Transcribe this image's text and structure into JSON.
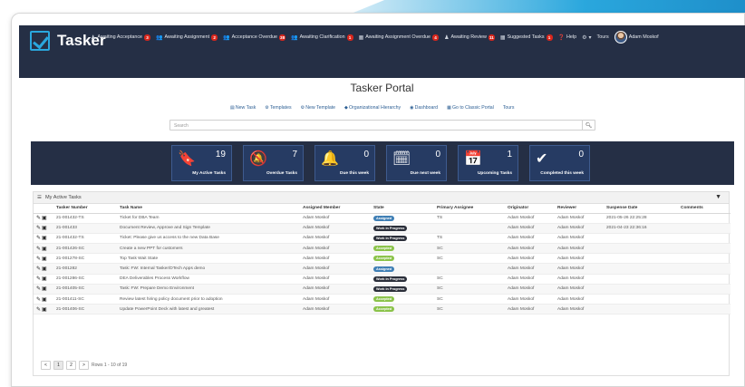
{
  "brand": "Tasker",
  "nav": [
    {
      "icon": "user-icon",
      "glyph": "♟",
      "label": "Awaiting Acceptance",
      "count": "3"
    },
    {
      "icon": "users-icon",
      "glyph": "👥",
      "label": "Awaiting Assignment",
      "count": "2"
    },
    {
      "icon": "users-icon",
      "glyph": "👥",
      "label": "Acceptance Overdue",
      "count": "38"
    },
    {
      "icon": "users-icon",
      "glyph": "👥",
      "label": "Awaiting Clarification",
      "count": "1"
    },
    {
      "icon": "bank-icon",
      "glyph": "▦",
      "label": "Awaiting Assignment Overdue",
      "count": "4"
    },
    {
      "icon": "user-icon",
      "glyph": "♟",
      "label": "Awaiting Review",
      "count": "11"
    },
    {
      "icon": "bank-icon",
      "glyph": "▦",
      "label": "Suggested Tasks",
      "count": "1"
    }
  ],
  "help_label": "Help",
  "tours_label": "Tours",
  "user_name": "Adam Moskof",
  "portal_title": "Tasker Portal",
  "links": [
    {
      "name": "new-task-link",
      "icon": "▤",
      "label": "New Task"
    },
    {
      "name": "templates-link",
      "icon": "⚙",
      "label": "Templates"
    },
    {
      "name": "new-template-link",
      "icon": "⚙",
      "label": "New Template"
    },
    {
      "name": "org-hierarchy-link",
      "icon": "◆",
      "label": "Organizational Hierarchy"
    },
    {
      "name": "dashboard-link",
      "icon": "◉",
      "label": "Dashboard"
    },
    {
      "name": "classic-portal-link",
      "icon": "▦",
      "label": "Go to Classic Portal"
    },
    {
      "name": "tours-link",
      "icon": "",
      "label": "Tours"
    }
  ],
  "search_placeholder": "Search",
  "tiles": [
    {
      "name": "my-active-tasks-tile",
      "icon": "bookmark-icon",
      "glyph": "🔖",
      "value": "19",
      "label": "My Active Tasks"
    },
    {
      "name": "overdue-tasks-tile",
      "icon": "bell-slash-icon",
      "glyph": "🔕",
      "value": "7",
      "label": "Overdue Tasks"
    },
    {
      "name": "due-this-week-tile",
      "icon": "bell-icon",
      "glyph": "🔔",
      "value": "0",
      "label": "Due this week"
    },
    {
      "name": "due-next-week-tile",
      "icon": "calendar-icon",
      "glyph": "🗓",
      "value": "0",
      "label": "Due next week"
    },
    {
      "name": "upcoming-tasks-tile",
      "icon": "calendar-grid-icon",
      "glyph": "📅",
      "value": "1",
      "label": "Upcoming Tasks"
    },
    {
      "name": "completed-this-week-tile",
      "icon": "check-icon",
      "glyph": "✔",
      "value": "0",
      "label": "Completed this week"
    }
  ],
  "panel_title": "My Active Tasks",
  "columns": [
    "Tasker Number",
    "Task Name",
    "Assigned Member",
    "State",
    "Primary Assignee",
    "Originator",
    "Reviewer",
    "Suspense Date",
    "Comments"
  ],
  "state_colors": {
    "Assigned": "#3f7fb5",
    "Work in Progress": "#2b2f3a",
    "Accepted": "#8bc34a"
  },
  "rows": [
    {
      "num": "21-001432-TS",
      "task": "Ticket for DBA Team",
      "member": "Adam Moskof",
      "state": "Assigned",
      "primary": "TS",
      "orig": "Adam Moskof",
      "rev": "Adam Moskof",
      "date": "2021-05-26 22:25:28",
      "comments": ""
    },
    {
      "num": "21-001433",
      "task": "Document Review, Approve and Sign Template",
      "member": "Adam Moskof",
      "state": "Work in Progress",
      "primary": "",
      "orig": "Adam Moskof",
      "rev": "Adam Moskof",
      "date": "2021-04-23 22:36:16",
      "comments": ""
    },
    {
      "num": "21-001432-TS",
      "task": "Ticket: Please give us access to the new Data Base",
      "member": "Adam Moskof",
      "state": "Work in Progress",
      "primary": "TS",
      "orig": "Adam Moskof",
      "rev": "Adam Moskof",
      "date": "",
      "comments": ""
    },
    {
      "num": "21-001426-SC",
      "task": "Create a new PPT for customers",
      "member": "Adam Moskof",
      "state": "Accepted",
      "primary": "SC",
      "orig": "Adam Moskof",
      "rev": "Adam Moskof",
      "date": "",
      "comments": ""
    },
    {
      "num": "21-001278-SC",
      "task": "Top Task Wait State",
      "member": "Adam Moskof",
      "state": "Accepted",
      "primary": "SC",
      "orig": "Adam Moskof",
      "rev": "Adam Moskof",
      "date": "",
      "comments": ""
    },
    {
      "num": "21-001282",
      "task": "Task: FW: Internal Tasker/DTech Apps demo",
      "member": "Adam Moskof",
      "state": "Assigned",
      "primary": "",
      "orig": "Adam Moskof",
      "rev": "Adam Moskof",
      "date": "",
      "comments": ""
    },
    {
      "num": "21-001286-SC",
      "task": "DEA Deliverables Process Workflow",
      "member": "Adam Moskof",
      "state": "Work in Progress",
      "primary": "SC",
      "orig": "Adam Moskof",
      "rev": "Adam Moskof",
      "date": "",
      "comments": ""
    },
    {
      "num": "21-001405-SC",
      "task": "Task: FW: Prepare Demo Environment",
      "member": "Adam Moskof",
      "state": "Work in Progress",
      "primary": "SC",
      "orig": "Adam Moskof",
      "rev": "Adam Moskof",
      "date": "",
      "comments": ""
    },
    {
      "num": "21-001411-SC",
      "task": "Review latest hiring policy document prior to adoption",
      "member": "Adam Moskof",
      "state": "Accepted",
      "primary": "SC",
      "orig": "Adam Moskof",
      "rev": "Adam Moskof",
      "date": "",
      "comments": ""
    },
    {
      "num": "21-001406-SC",
      "task": "Update PowerPoint Deck with latest and greatest",
      "member": "Adam Moskof",
      "state": "Accepted",
      "primary": "SC",
      "orig": "Adam Moskof",
      "rev": "Adam Moskof",
      "date": "",
      "comments": ""
    }
  ],
  "pager": {
    "pages": [
      "1",
      "2"
    ],
    "summary": "Rows 1 - 10 of 19"
  }
}
